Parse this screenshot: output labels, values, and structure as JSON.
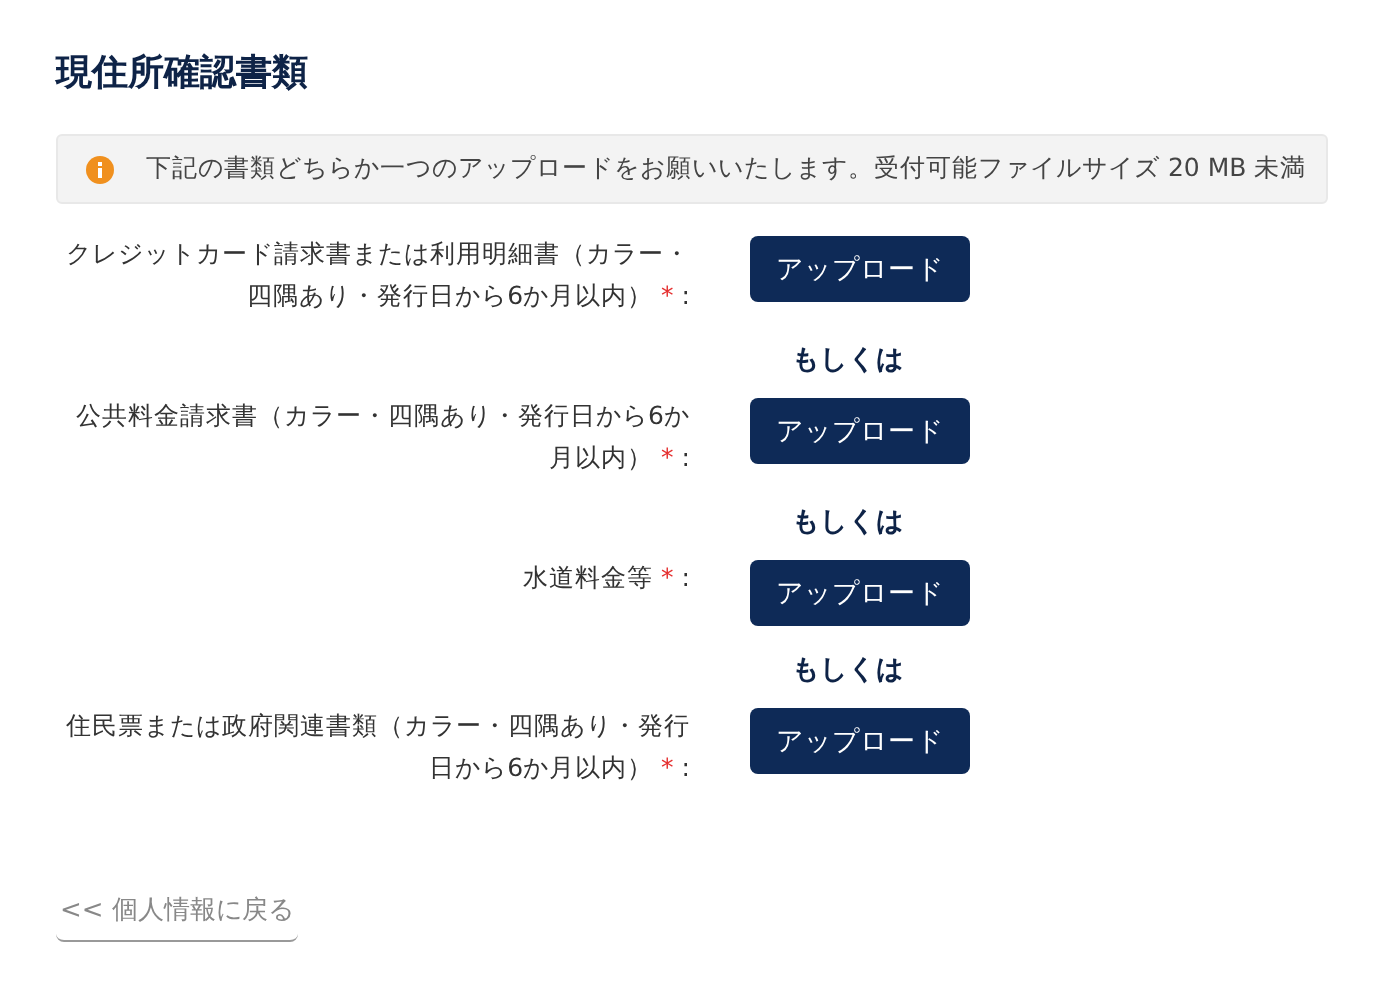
{
  "title": "現住所確認書類",
  "notice": {
    "text": "下記の書類どちらか一つのアップロードをお願いいたします。受付可能ファイルサイズ 20 MB 未満"
  },
  "items": [
    {
      "kind": "upload",
      "label": "クレジットカード請求書または利用明細書（カラー・四隅あり・発行日から6か月以内）",
      "required_mark": "*",
      "colon": ":",
      "button": "アップロード"
    },
    {
      "kind": "separator",
      "text": "もしくは"
    },
    {
      "kind": "upload",
      "label": "公共料金請求書（カラー・四隅あり・発行日から6か月以内）",
      "required_mark": "*",
      "colon": ":",
      "button": "アップロード"
    },
    {
      "kind": "separator",
      "text": "もしくは"
    },
    {
      "kind": "upload",
      "label": "水道料金等",
      "required_mark": "*",
      "colon": ":",
      "button": "アップロード"
    },
    {
      "kind": "separator",
      "text": "もしくは"
    },
    {
      "kind": "upload",
      "label": "住民票または政府関連書類（カラー・四隅あり・発行日から6か月以内）",
      "required_mark": "*",
      "colon": ":",
      "button": "アップロード"
    }
  ],
  "back_link": "<< 個人情報に戻る"
}
